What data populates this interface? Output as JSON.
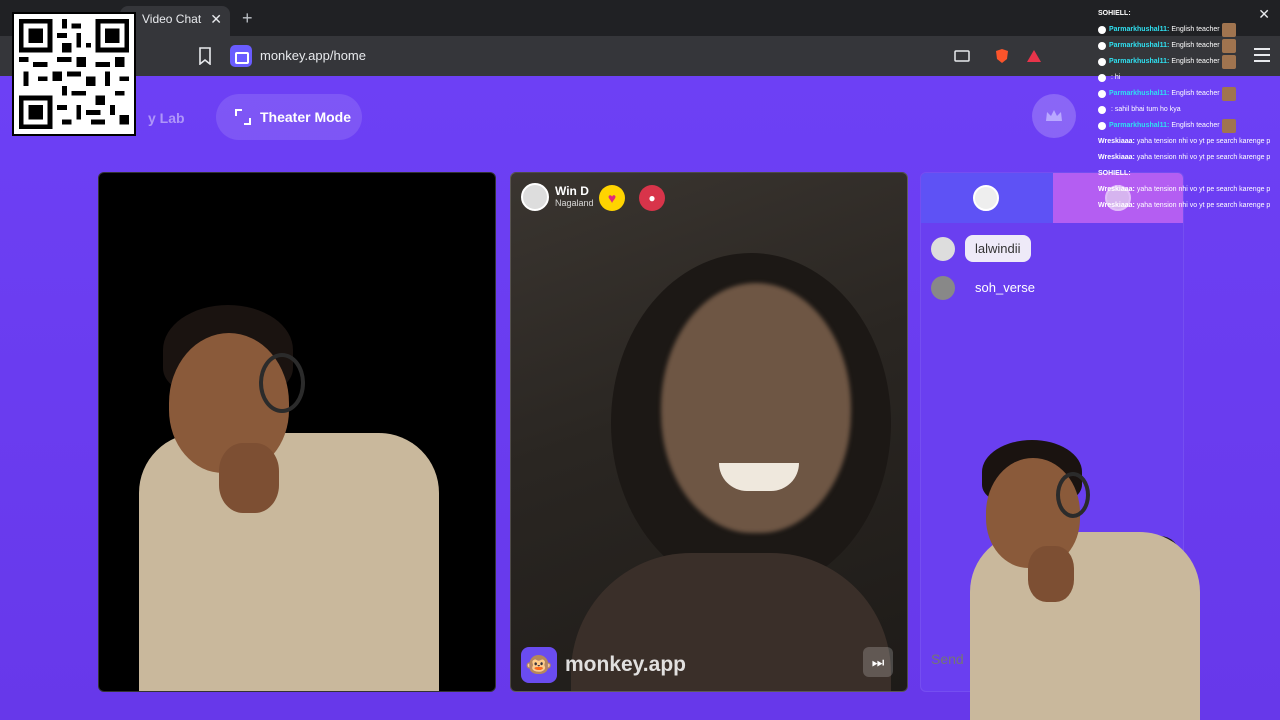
{
  "browser": {
    "tab_title": "Video Chat",
    "url": "monkey.app/home"
  },
  "page": {
    "lab_label": "y Lab",
    "theater_label": "Theater Mode"
  },
  "peer": {
    "name": "Win D",
    "location": "Nagaland"
  },
  "brand": {
    "name": "monkey.app"
  },
  "chat": {
    "messages": [
      {
        "text": "lalwindii"
      },
      {
        "text": "soh_verse"
      }
    ],
    "send_placeholder": "Send"
  },
  "stream_chat": [
    {
      "user": "SOHIELL:",
      "text": ""
    },
    {
      "user": "Parmarkhushal11:",
      "text": "English teacher"
    },
    {
      "user": "Parmarkhushal11:",
      "text": "English teacher"
    },
    {
      "user": "Parmarkhushal11:",
      "text": "English teacher"
    },
    {
      "user": "",
      "text": ": hi"
    },
    {
      "user": "Parmarkhushal11:",
      "text": "English teacher"
    },
    {
      "user": "",
      "text": ": sahil bhai tum ho kya"
    },
    {
      "user": "Parmarkhushal11:",
      "text": "English teacher"
    },
    {
      "user": "Wreskiaaa:",
      "text": "yaha tension nhi vo yt pe search karenge p"
    },
    {
      "user": "Wreskiaaa:",
      "text": "yaha tension nhi vo yt pe search karenge p"
    },
    {
      "user": "SOHIELL:",
      "text": ""
    },
    {
      "user": "Wreskiaaa:",
      "text": "yaha tension nhi vo yt pe search karenge p"
    },
    {
      "user": "Wreskiaaa:",
      "text": "yaha tension nhi vo yt pe search karenge p"
    }
  ],
  "colors": {
    "page_bg": "#6b3cf2",
    "chat_header": "#5e52f5",
    "chat_header_accent": "#b45ef2",
    "stream_user": "#2fe0f0"
  }
}
